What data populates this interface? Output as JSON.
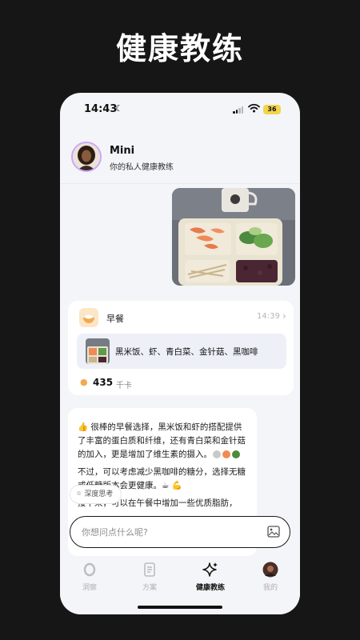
{
  "promo": {
    "headline": "健康教练"
  },
  "status_bar": {
    "time": "14:43",
    "battery": "36"
  },
  "coach": {
    "name": "Mini",
    "subtitle": "你的私人健康教练"
  },
  "record": {
    "meal": "早餐",
    "time": "14:39",
    "foods": "黑米饭、虾、青白菜、金针菇、黑咖啡",
    "calories": "435",
    "calories_unit": "千卡"
  },
  "advice": {
    "p1": "👍 很棒的早餐选择，黑米饭和虾的搭配提供了丰富的蛋白质和纤维，还有青白菜和金针菇的加入，更是增加了维生素的摄入。",
    "p2": "不过，可以考虑减少黑咖啡的糖分，选择无糖或低糖版本会更健康。☕ 💪",
    "p3": "接下来，可以在午餐中增加一些优质脂肪，"
  },
  "deep_think": {
    "label": "深度思考"
  },
  "input": {
    "placeholder": "你想问点什么呢?"
  },
  "tabs": [
    {
      "label": "洞察",
      "icon": "ring-icon",
      "active": false
    },
    {
      "label": "方案",
      "icon": "document-icon",
      "active": false
    },
    {
      "label": "健康教练",
      "icon": "sparkle-icon",
      "active": true
    },
    {
      "label": "我的",
      "icon": "avatar-icon",
      "active": false
    }
  ],
  "colors": {
    "background": "#161616",
    "phone": "#f4f5f8",
    "card": "#ffffff",
    "accent_border": "#c9a7ff",
    "battery": "#f2d44a",
    "calorie_icon": "#f4a94e"
  }
}
